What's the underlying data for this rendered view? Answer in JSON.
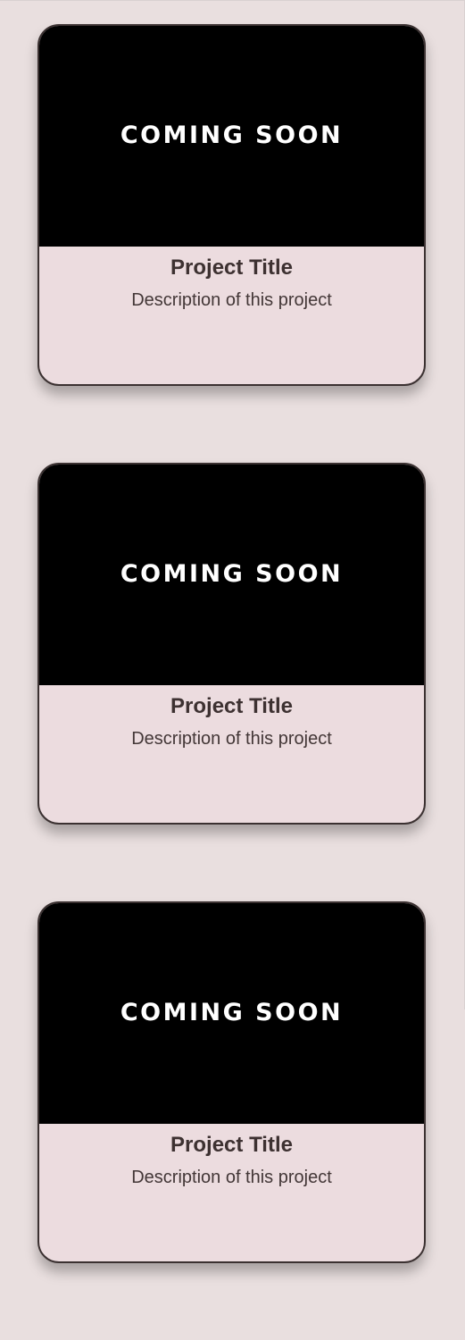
{
  "projects": [
    {
      "badge": "COMING SOON",
      "title": "Project Title",
      "description": "Description of this project"
    },
    {
      "badge": "COMING SOON",
      "title": "Project Title",
      "description": "Description of this project"
    },
    {
      "badge": "COMING SOON",
      "title": "Project Title",
      "description": "Description of this project"
    }
  ],
  "colors": {
    "page_background": "#e9dfdf",
    "card_body": "#ecdcdf",
    "card_image": "#000000",
    "card_border": "#3b3131",
    "title_text": "#3d3131"
  }
}
